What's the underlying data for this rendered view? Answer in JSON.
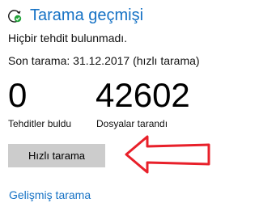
{
  "header": {
    "title": "Tarama geçmişi",
    "icon": "history-clock-icon",
    "accent_color": "#1672c5"
  },
  "status": {
    "message": "Hiçbir tehdit bulunmadı.",
    "last_scan": "Son tarama: 31.12.2017 (hızlı tarama)"
  },
  "stats": {
    "threats_count": "0",
    "threats_label": "Tehditler buldu",
    "files_count": "42602",
    "files_label": "Dosyalar tarandı"
  },
  "actions": {
    "quick_scan_label": "Hızlı tarama",
    "advanced_scan_label": "Gelişmiş tarama"
  },
  "annotation": {
    "arrow_color": "#e8202a",
    "arrow_icon": "left-arrow-icon"
  }
}
